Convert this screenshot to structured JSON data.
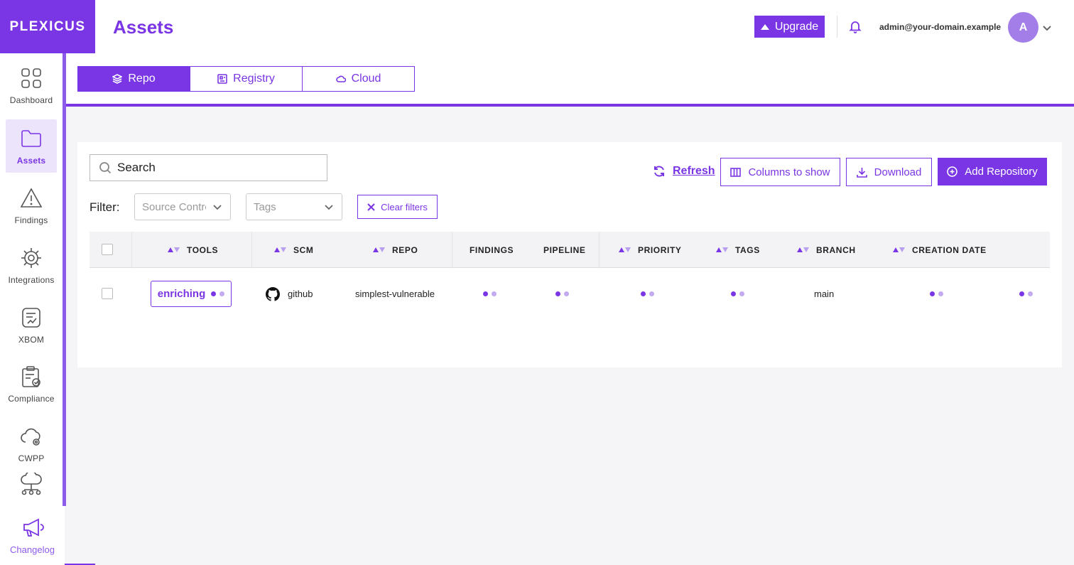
{
  "brand": {
    "logo_text": "PLEXICUS",
    "accent": "#7a35e4"
  },
  "sidebar": {
    "items": [
      {
        "label": "Dashboard",
        "icon": "grid-icon",
        "active": false
      },
      {
        "label": "Assets",
        "icon": "folder-icon",
        "active": true
      },
      {
        "label": "Findings",
        "icon": "warning-icon",
        "active": false
      },
      {
        "label": "Integrations",
        "icon": "gear-icon",
        "active": false
      },
      {
        "label": "XBOM",
        "icon": "document-icon",
        "active": false
      },
      {
        "label": "Compliance",
        "icon": "clipboard-check-icon",
        "active": false
      },
      {
        "label": "CWPP",
        "icon": "cloud-gear-icon",
        "active": false
      },
      {
        "label": "",
        "icon": "cloud-network-icon",
        "active": false
      }
    ],
    "changelog_label": "Changelog"
  },
  "header": {
    "title": "Assets",
    "upgrade_label": "Upgrade",
    "user_email": "admin@your-domain.example",
    "avatar_initial": "A"
  },
  "tabs": [
    {
      "label": "Repo",
      "active": true
    },
    {
      "label": "Registry",
      "active": false
    },
    {
      "label": "Cloud",
      "active": false
    }
  ],
  "toolbar": {
    "search_placeholder": "Search",
    "refresh_label": "Refresh",
    "columns_label": "Columns to show",
    "download_label": "Download",
    "add_label": "Add Repository"
  },
  "filters": {
    "label": "Filter:",
    "source_placeholder": "Source Control",
    "tags_placeholder": "Tags",
    "clear_label": "Clear filters"
  },
  "table": {
    "columns": [
      "TOOLS",
      "SCM",
      "REPO",
      "FINDINGS",
      "PIPELINE",
      "PRIORITY",
      "TAGS",
      "BRANCH",
      "CREATION DATE"
    ],
    "rows": [
      {
        "tools": "enriching",
        "scm": "github",
        "repo": "simplest-vulnerable",
        "branch": "main"
      }
    ]
  }
}
